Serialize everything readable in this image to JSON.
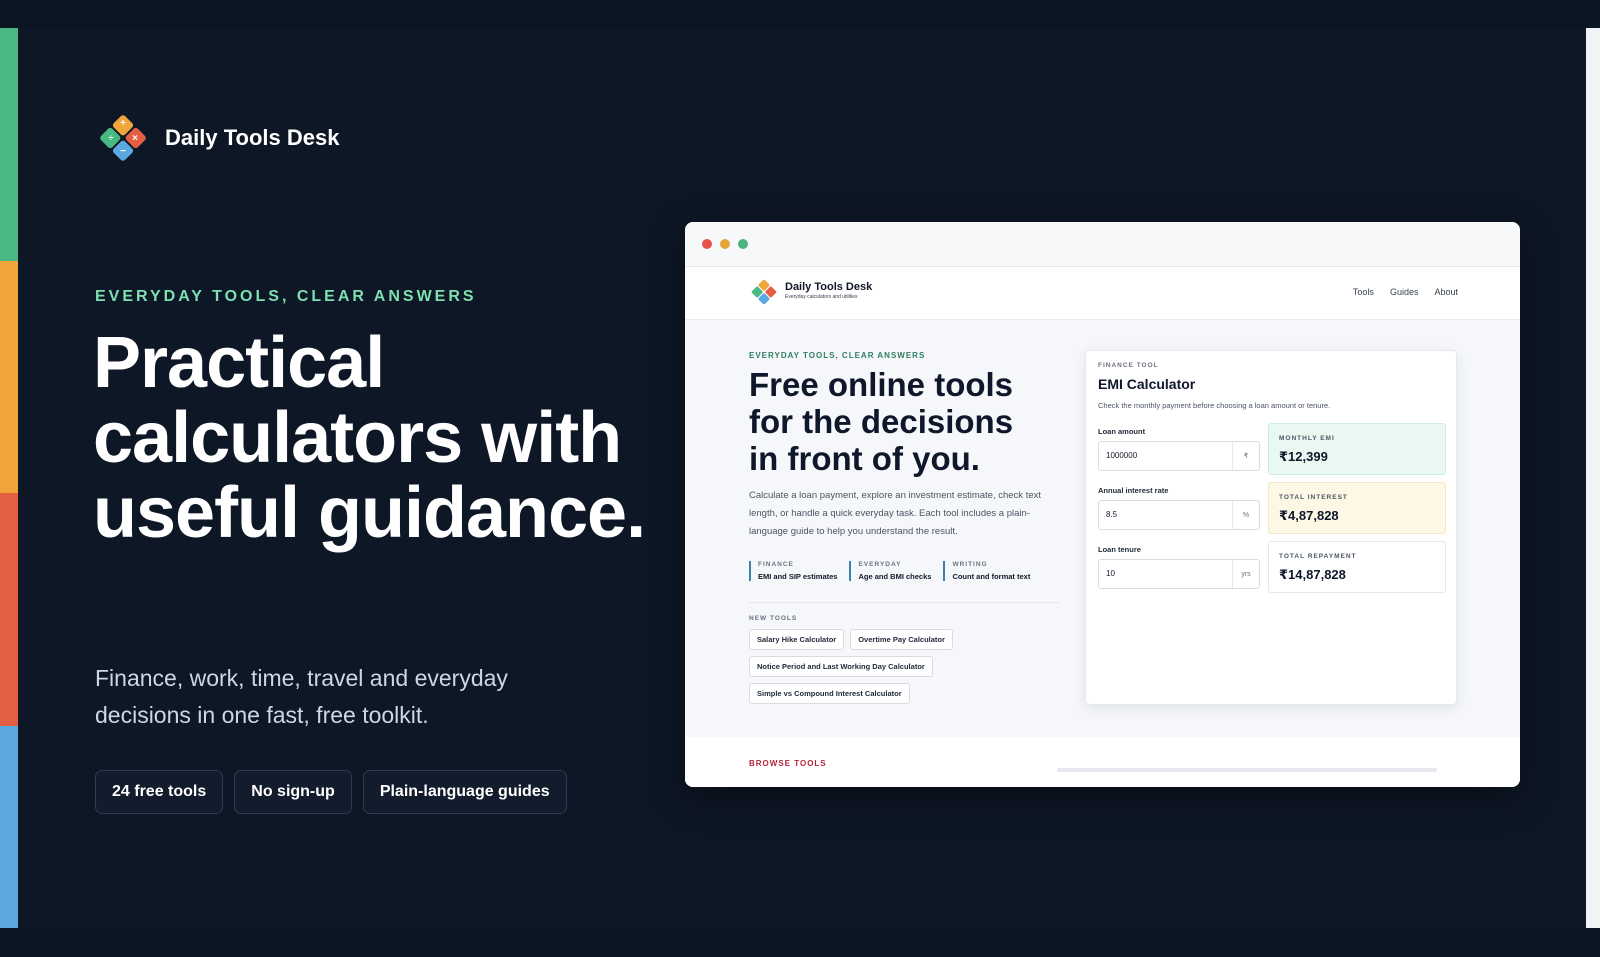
{
  "brand": {
    "name": "Daily Tools Desk",
    "logo_icon": "calculator-tiles-icon"
  },
  "stripes": [
    "#4ab883",
    "#f0a53b",
    "#e45f42",
    "#5aa8df"
  ],
  "hero": {
    "eyebrow": "EVERYDAY TOOLS, CLEAR ANSWERS",
    "title": "Practical calculators with useful guidance.",
    "subtitle": "Finance, work, time, travel and everyday decisions in one fast, free toolkit.",
    "pills": [
      "24 free tools",
      "No sign-up",
      "Plain-language guides"
    ]
  },
  "preview": {
    "window_dots": [
      "#e5534b",
      "#e4a53a",
      "#4cb37c"
    ],
    "brand_name": "Daily Tools Desk",
    "brand_tagline": "Everyday calculators and utilities",
    "nav": [
      "Tools",
      "Guides",
      "About"
    ],
    "eyebrow": "EVERYDAY TOOLS, CLEAR ANSWERS",
    "title": "Free online tools for the decisions in front of you.",
    "description": "Calculate a loan payment, explore an investment estimate, check text length, or handle a quick everyday task. Each tool includes a plain-language guide to help you understand the result.",
    "categories": [
      {
        "label": "FINANCE",
        "desc": "EMI and SIP estimates"
      },
      {
        "label": "EVERYDAY",
        "desc": "Age and BMI checks"
      },
      {
        "label": "WRITING",
        "desc": "Count and format text"
      }
    ],
    "new_tools_label": "NEW TOOLS",
    "new_tools": [
      "Salary Hike Calculator",
      "Overtime Pay Calculator",
      "Notice Period and Last Working Day Calculator",
      "Simple vs Compound Interest Calculator"
    ],
    "calculator": {
      "tag": "FINANCE TOOL",
      "title": "EMI Calculator",
      "description": "Check the monthly payment before choosing a loan amount or tenure.",
      "fields": [
        {
          "label": "Loan amount",
          "value": "1000000",
          "unit": "₹"
        },
        {
          "label": "Annual interest rate",
          "value": "8.5",
          "unit": "%"
        },
        {
          "label": "Loan tenure",
          "value": "10",
          "unit": "yrs"
        }
      ],
      "results": [
        {
          "label": "MONTHLY EMI",
          "value": "₹12,399",
          "bg": "#e9f8f0"
        },
        {
          "label": "TOTAL INTEREST",
          "value": "₹4,87,828",
          "bg": "#fdf7e6"
        },
        {
          "label": "TOTAL REPAYMENT",
          "value": "₹14,87,828",
          "bg": "#ffffff"
        }
      ]
    },
    "browse_label": "BROWSE TOOLS"
  }
}
